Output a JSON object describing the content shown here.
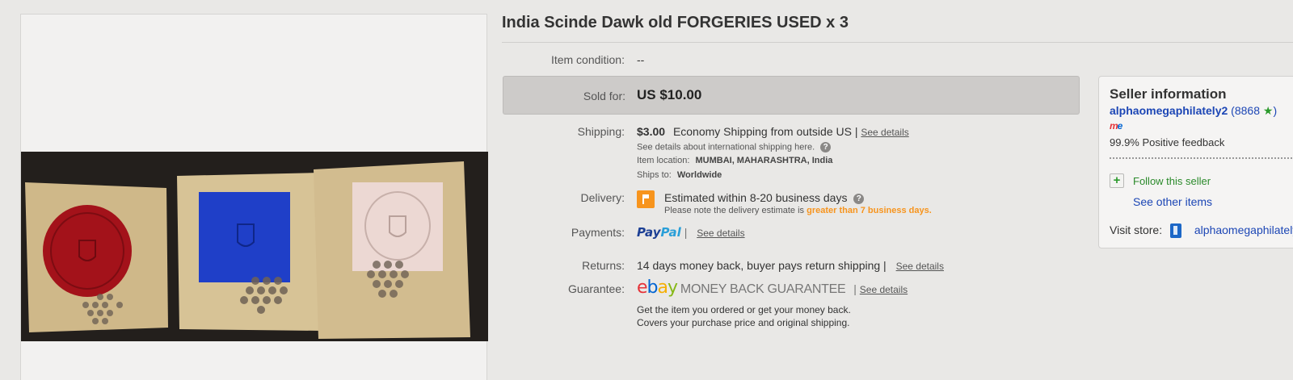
{
  "listing": {
    "title": "India Scinde Dawk old FORGERIES USED x 3"
  },
  "details": {
    "condition_label": "Item condition:",
    "condition_value": "--",
    "sold_label": "Sold for:",
    "sold_price": "US $10.00",
    "shipping_label": "Shipping:",
    "shipping_cost": "$3.00",
    "shipping_method": "Economy Shipping from outside US |",
    "see_details": "See details",
    "intl_shipping_note": "See details about international shipping here.",
    "item_location_label": "Item location:",
    "item_location": "MUMBAI, MAHARASHTRA, India",
    "ships_to_label": "Ships to:",
    "ships_to": "Worldwide",
    "delivery_label": "Delivery:",
    "delivery_estimate": "Estimated within 8-20 business days",
    "delivery_note_prefix": "Please note the delivery estimate is",
    "delivery_note_highlight": "greater than 7 business days.",
    "payments_label": "Payments:",
    "paypal_part1": "Pay",
    "paypal_part2": "Pal",
    "returns_label": "Returns:",
    "returns_value": "14 days money back, buyer pays return shipping |",
    "guarantee_label": "Guarantee:",
    "ebay_e": "e",
    "ebay_b": "b",
    "ebay_a": "a",
    "ebay_y": "y",
    "mbg_text": "MONEY BACK GUARANTEE",
    "guarantee_line1": "Get the item you ordered or get your money back.",
    "guarantee_line2": "Covers your purchase price and original shipping."
  },
  "seller": {
    "title": "Seller information",
    "name": "alphaomegaphilately2",
    "score_open": "(",
    "score": "8868",
    "score_close": ")",
    "me_m": "m",
    "me_e": "e",
    "feedback": "99.9% Positive feedback",
    "follow": "Follow this seller",
    "other_items": "See other items",
    "visit_store_label": "Visit store:",
    "store_name": "alphaomegaphilatelyindia"
  },
  "icons": {
    "help": "question-circle-icon",
    "delivery": "orange-flag-icon",
    "star": "green-star-icon",
    "follow": "plus-icon",
    "store": "store-icon"
  },
  "colors": {
    "link_blue": "#1c46b5",
    "orange": "#f7941d",
    "green": "#2b9a2b",
    "sold_box": "#cdcbc9"
  }
}
